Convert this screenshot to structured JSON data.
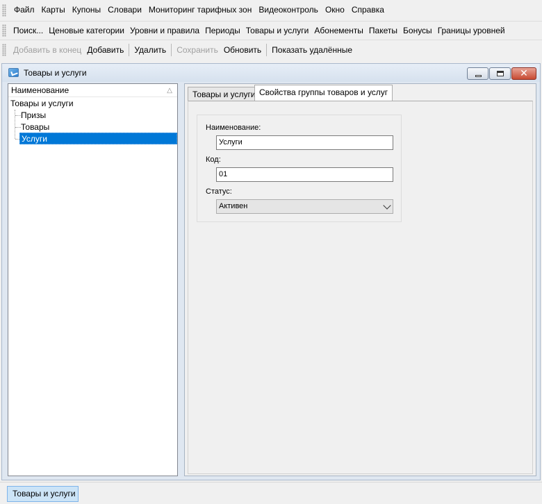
{
  "menubar": {
    "items": [
      "Файл",
      "Карты",
      "Купоны",
      "Словари",
      "Мониторинг тарифных зон",
      "Видеоконтроль",
      "Окно",
      "Справка"
    ]
  },
  "navbar": {
    "items": [
      "Поиск...",
      "Ценовые категории",
      "Уровни и правила",
      "Периоды",
      "Товары и услуги",
      "Абонементы",
      "Пакеты",
      "Бонусы",
      "Границы уровней"
    ]
  },
  "actionbar": {
    "add_to_end": "Добавить в конец",
    "add": "Добавить",
    "delete": "Удалить",
    "save": "Сохранить",
    "refresh": "Обновить",
    "show_deleted": "Показать удалённые"
  },
  "window": {
    "title": "Товары и услуги",
    "close_glyph": "✕"
  },
  "tree": {
    "header": "Наименование",
    "sort_glyph": "△",
    "root": "Товары и услуги",
    "children": [
      "Призы",
      "Товары",
      "Услуги"
    ],
    "selected_index": 2
  },
  "tabs": {
    "goods": "Товары и услуги",
    "props": "Свойства группы товаров и услуг"
  },
  "form": {
    "name_label": "Наименование:",
    "name_value": "Услуги",
    "code_label": "Код:",
    "code_value": "01",
    "status_label": "Статус:",
    "status_value": "Активен"
  },
  "taskbar": {
    "window_button": "Товары и услуги"
  }
}
